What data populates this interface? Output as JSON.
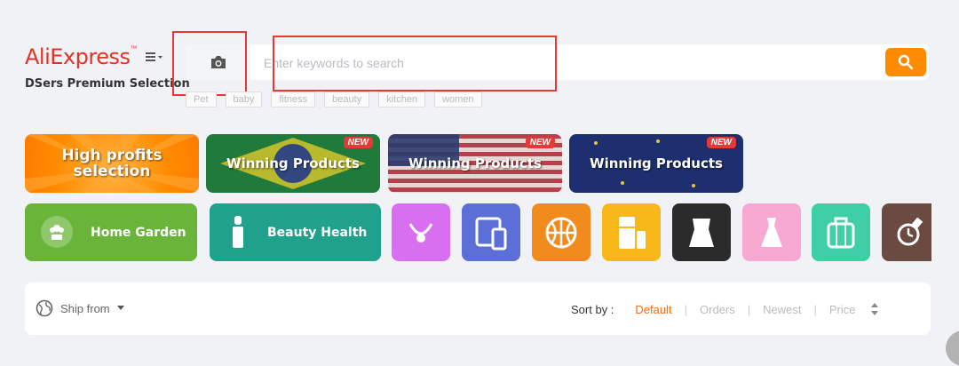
{
  "header": {
    "logo": "AliExpress",
    "subtitle": "DSers Premium Selection"
  },
  "search": {
    "placeholder": "Enter keywords to search",
    "value": ""
  },
  "tags": [
    "Pet",
    "baby",
    "fitness",
    "beauty",
    "kitchen",
    "women"
  ],
  "banners": [
    {
      "label": "High profits selection",
      "badge": ""
    },
    {
      "label": "Winning Products",
      "badge": "NEW"
    },
    {
      "label": "Winning Products",
      "badge": "NEW"
    },
    {
      "label": "Winning Products",
      "badge": "NEW"
    }
  ],
  "categories": [
    {
      "label": "Home Garden",
      "icon": "flower-icon"
    },
    {
      "label": "Beauty Health",
      "icon": "lipstick-icon"
    }
  ],
  "icon_categories": [
    {
      "icon": "jewelry-icon",
      "color": "#d86ff0"
    },
    {
      "icon": "devices-icon",
      "color": "#5b6fd6"
    },
    {
      "icon": "basketball-icon",
      "color": "#f28b1d"
    },
    {
      "icon": "appliance-icon",
      "color": "#f8b81a"
    },
    {
      "icon": "camisole-icon",
      "color": "#2b2b2b"
    },
    {
      "icon": "dress-icon",
      "color": "#f7a9d4"
    },
    {
      "icon": "luggage-icon",
      "color": "#3ecfa6"
    },
    {
      "icon": "watch-icon",
      "color": "#6b4a42"
    }
  ],
  "filters": {
    "ship_from": "Ship from",
    "sort_label": "Sort by :",
    "sort_options": [
      "Default",
      "Orders",
      "Newest",
      "Price"
    ],
    "active_sort": "Default"
  },
  "colors": {
    "accent": "#ff8c00",
    "brand": "#e43225"
  }
}
